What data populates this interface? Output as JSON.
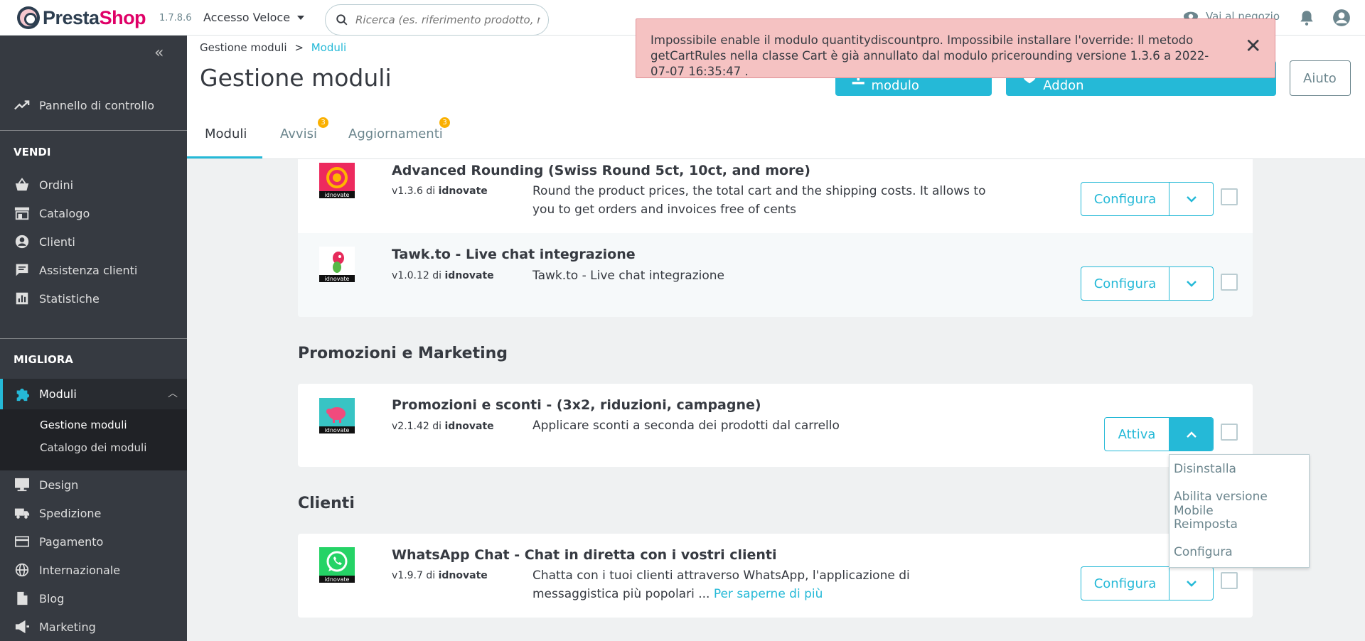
{
  "header": {
    "brand_presta": "Presta",
    "brand_shop": "Shop",
    "version": "1.7.8.6",
    "quick_access": "Accesso Veloce",
    "search_placeholder": "Ricerca (es. riferimento prodotto, nom",
    "view_store": "Vai al negozio"
  },
  "sidebar": {
    "dashboard": "Pannello di controllo",
    "section_sell": "VENDI",
    "sell_items": [
      "Ordini",
      "Catalogo",
      "Clienti",
      "Assistenza clienti",
      "Statistiche"
    ],
    "section_improve": "MIGLIORA",
    "modules": "Moduli",
    "sub_items": [
      "Gestione moduli",
      "Catalogo dei moduli"
    ],
    "improve_items": [
      "Design",
      "Spedizione",
      "Pagamento",
      "Internazionale",
      "Blog",
      "Marketing"
    ]
  },
  "breadcrumb": {
    "parent": "Gestione moduli",
    "separator": ">",
    "current": "Moduli"
  },
  "page": {
    "title": "Gestione moduli",
    "upload_button": "Carica un modulo",
    "marketplace_button": "Collegati al Marketplace degli Addon",
    "help_button": "Aiuto"
  },
  "tabs": [
    {
      "label": "Moduli"
    },
    {
      "label": "Avvisi",
      "badge": "3"
    },
    {
      "label": "Aggiornamenti",
      "badge": "3"
    }
  ],
  "modules": {
    "advanced": {
      "name": "Advanced Rounding (Swiss Round 5ct, 10ct, and more)",
      "version": "v1.3.6 di",
      "author": "idnovate",
      "desc": "Round the product prices, the total cart and the shipping costs. It allows to you to get orders and invoices free of cents",
      "action": "Configura"
    },
    "tawk": {
      "name": "Tawk.to - Live chat integrazione",
      "version": "v1.0.12 di",
      "author": "idnovate",
      "desc": "Tawk.to - Live chat integrazione",
      "action": "Configura"
    },
    "promo": {
      "name": "Promozioni e sconti - (3x2, riduzioni, campagne)",
      "version": "v2.1.42 di",
      "author": "idnovate",
      "desc": "Applicare sconti a seconda dei prodotti dal carrello",
      "action": "Attiva"
    },
    "whatsapp": {
      "name": "WhatsApp Chat - Chat in diretta con i vostri clienti",
      "version": "v1.9.7 di",
      "author": "idnovate",
      "desc": "Chatta con i tuoi clienti attraverso WhatsApp, l'applicazione di messaggistica più popolari ...",
      "more": "Per saperne di più",
      "action": "Configura"
    }
  },
  "logo_label": "idnovate",
  "sections": {
    "promo": "Promozioni e Marketing",
    "clients": "Clienti"
  },
  "dropdown": [
    "Disinstalla",
    "Abilita versione Mobile",
    "Reimposta",
    "Configura"
  ],
  "alert": {
    "message": "Impossibile enable il modulo quantitydiscountpro. Impossibile installare l'override: Il metodo getCartRules nella classe Cart è già annullato dal modulo pricerounding versione 1.3.6 a 2022-07-07 16:35:47 ."
  },
  "colors": {
    "accent": "#25b9d7",
    "sidebar": "#363a41",
    "alert_bg": "#f5c2c2",
    "badge": "#fab000"
  }
}
